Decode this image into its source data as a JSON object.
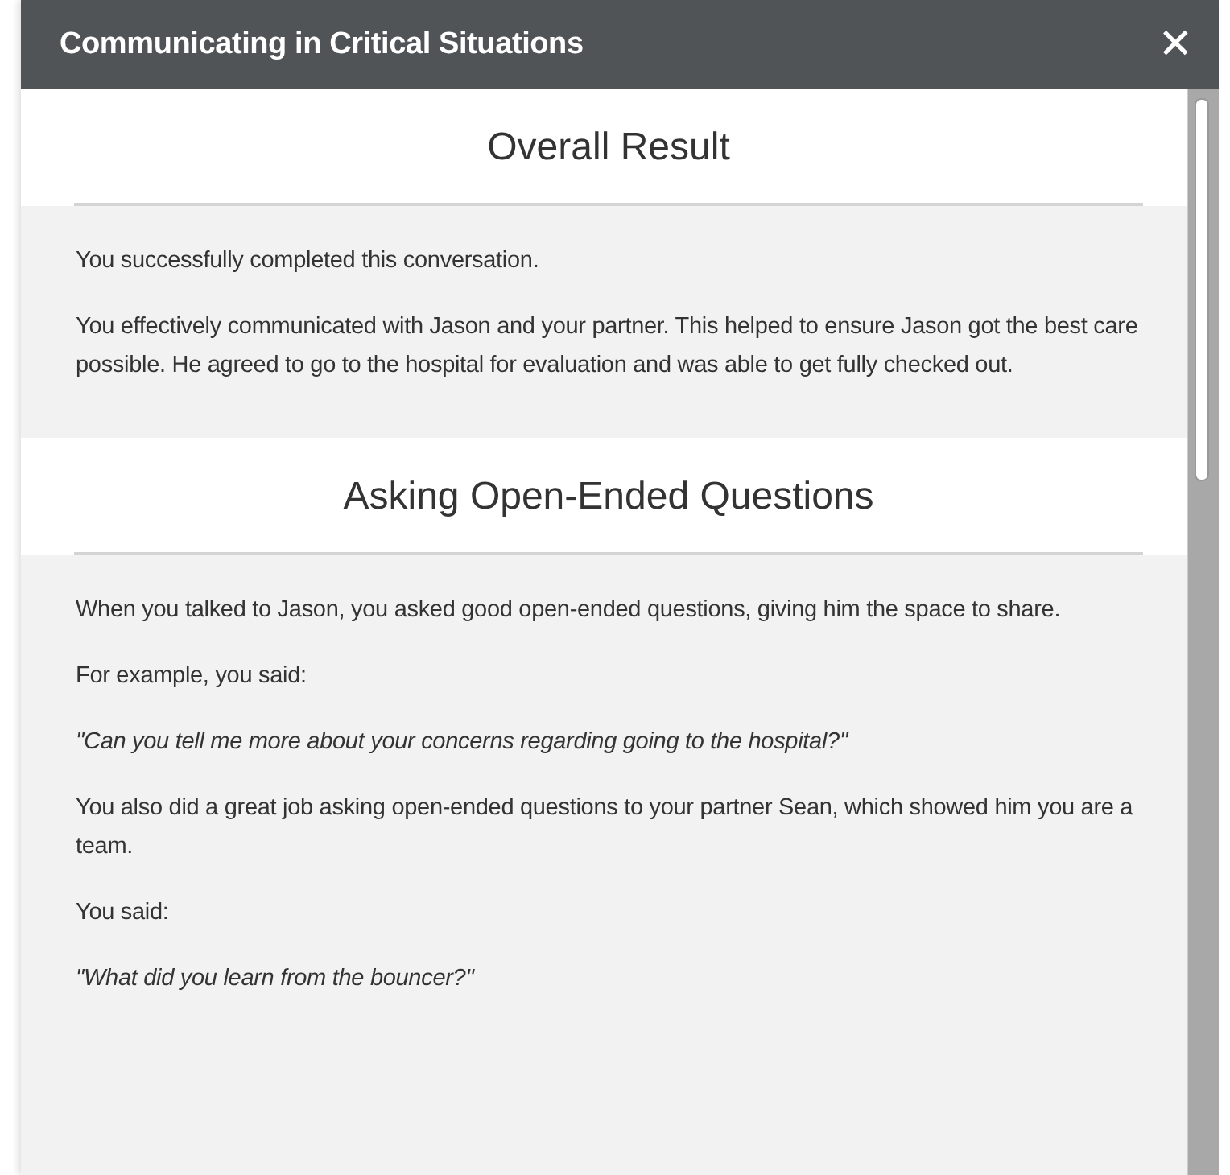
{
  "window": {
    "title": "Communicating in Critical Situations",
    "close": "✕"
  },
  "sections": [
    {
      "heading": "Overall Result",
      "paragraphs": [
        {
          "kind": "text",
          "text": "You successfully completed this conversation."
        },
        {
          "kind": "text",
          "text": "You effectively communicated with Jason and your partner. This helped to ensure Jason got the best care possible. He agreed to go to the hospital for evaluation and was able to get fully checked out."
        }
      ]
    },
    {
      "heading": "Asking Open-Ended Questions",
      "paragraphs": [
        {
          "kind": "text",
          "text": "When you talked to Jason, you asked good open-ended questions, giving him the space to share."
        },
        {
          "kind": "text",
          "text": "For example, you said:"
        },
        {
          "kind": "quote",
          "text": "\"Can you tell me more about your concerns regarding going to the hospital?\""
        },
        {
          "kind": "text",
          "text": "You also did a great job asking open-ended questions to your partner Sean, which showed him you are a team."
        },
        {
          "kind": "text",
          "text": "You said:"
        },
        {
          "kind": "quote",
          "text": "\"What did you learn from the bouncer?\""
        }
      ]
    }
  ]
}
